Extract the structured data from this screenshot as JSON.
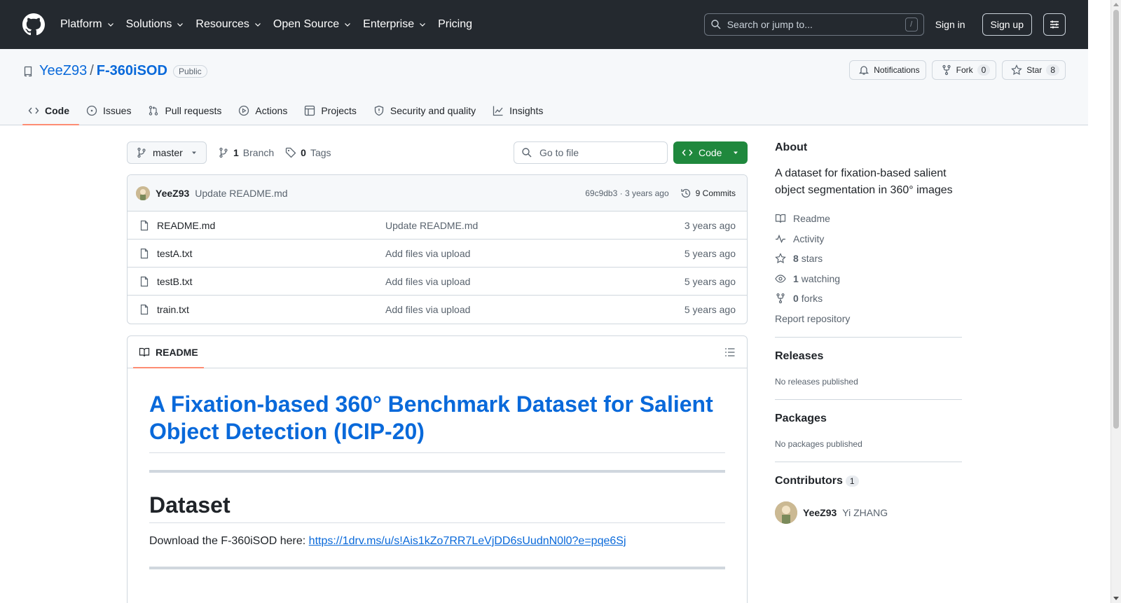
{
  "header": {
    "nav": [
      {
        "label": "Platform",
        "dropdown": true
      },
      {
        "label": "Solutions",
        "dropdown": true
      },
      {
        "label": "Resources",
        "dropdown": true
      },
      {
        "label": "Open Source",
        "dropdown": true
      },
      {
        "label": "Enterprise",
        "dropdown": true
      },
      {
        "label": "Pricing",
        "dropdown": false
      }
    ],
    "search_placeholder": "Search or jump to...",
    "search_shortcut": "/",
    "signin": "Sign in",
    "signup": "Sign up"
  },
  "repo": {
    "owner": "YeeZ93",
    "separator": "/",
    "name": "F-360iSOD",
    "visibility": "Public",
    "notifications_label": "Notifications",
    "fork_label": "Fork",
    "fork_count": "0",
    "star_label": "Star",
    "star_count": "8"
  },
  "tabs": [
    {
      "label": "Code",
      "icon": "code-icon",
      "active": true
    },
    {
      "label": "Issues",
      "icon": "issue-icon"
    },
    {
      "label": "Pull requests",
      "icon": "pull-request-icon"
    },
    {
      "label": "Actions",
      "icon": "play-icon"
    },
    {
      "label": "Projects",
      "icon": "table-icon"
    },
    {
      "label": "Security and quality",
      "icon": "shield-icon"
    },
    {
      "label": "Insights",
      "icon": "graph-icon"
    }
  ],
  "toolbar": {
    "branch": "master",
    "branch_count": "1",
    "branch_label": "Branch",
    "tag_count": "0",
    "tag_label": "Tags",
    "goto_placeholder": "Go to file",
    "code_button": "Code"
  },
  "latest_commit": {
    "author": "YeeZ93",
    "message": "Update README.md",
    "meta": "69c9db3 · 3 years ago",
    "commits_label": "9 Commits"
  },
  "files": [
    {
      "name": "README.md",
      "commit": "Update README.md",
      "age": "3 years ago"
    },
    {
      "name": "testA.txt",
      "commit": "Add files via upload",
      "age": "5 years ago"
    },
    {
      "name": "testB.txt",
      "commit": "Add files via upload",
      "age": "5 years ago"
    },
    {
      "name": "train.txt",
      "commit": "Add files via upload",
      "age": "5 years ago"
    }
  ],
  "readme": {
    "tab_label": "README",
    "title": "A Fixation-based 360° Benchmark Dataset for Salient Object Detection (ICIP-20)",
    "section_heading": "Dataset",
    "download_text": "Download the F-360iSOD here: ",
    "download_link": "https://1drv.ms/u/s!Ais1kZo7RR7LeVjDD6sUudnN0l0?e=pqe6Sj"
  },
  "about": {
    "heading": "About",
    "description": "A dataset for fixation-based salient object segmentation in 360° images",
    "items": [
      {
        "icon": "book-icon",
        "count": "",
        "label": "Readme"
      },
      {
        "icon": "pulse-icon",
        "count": "",
        "label": "Activity"
      },
      {
        "icon": "star-icon",
        "count": "8",
        "label": "stars"
      },
      {
        "icon": "eye-icon",
        "count": "1",
        "label": "watching"
      },
      {
        "icon": "fork-icon",
        "count": "0",
        "label": "forks"
      }
    ],
    "report": "Report repository"
  },
  "releases": {
    "heading": "Releases",
    "empty": "No releases published"
  },
  "packages": {
    "heading": "Packages",
    "empty": "No packages published"
  },
  "contributors": {
    "heading": "Contributors",
    "count": "1",
    "list": [
      {
        "login": "YeeZ93",
        "name": "Yi ZHANG"
      }
    ]
  },
  "colors": {
    "header_bg": "#24292f",
    "link": "#0969da",
    "primary_button": "#1f883d",
    "active_tab_underline": "#fd8c73"
  }
}
